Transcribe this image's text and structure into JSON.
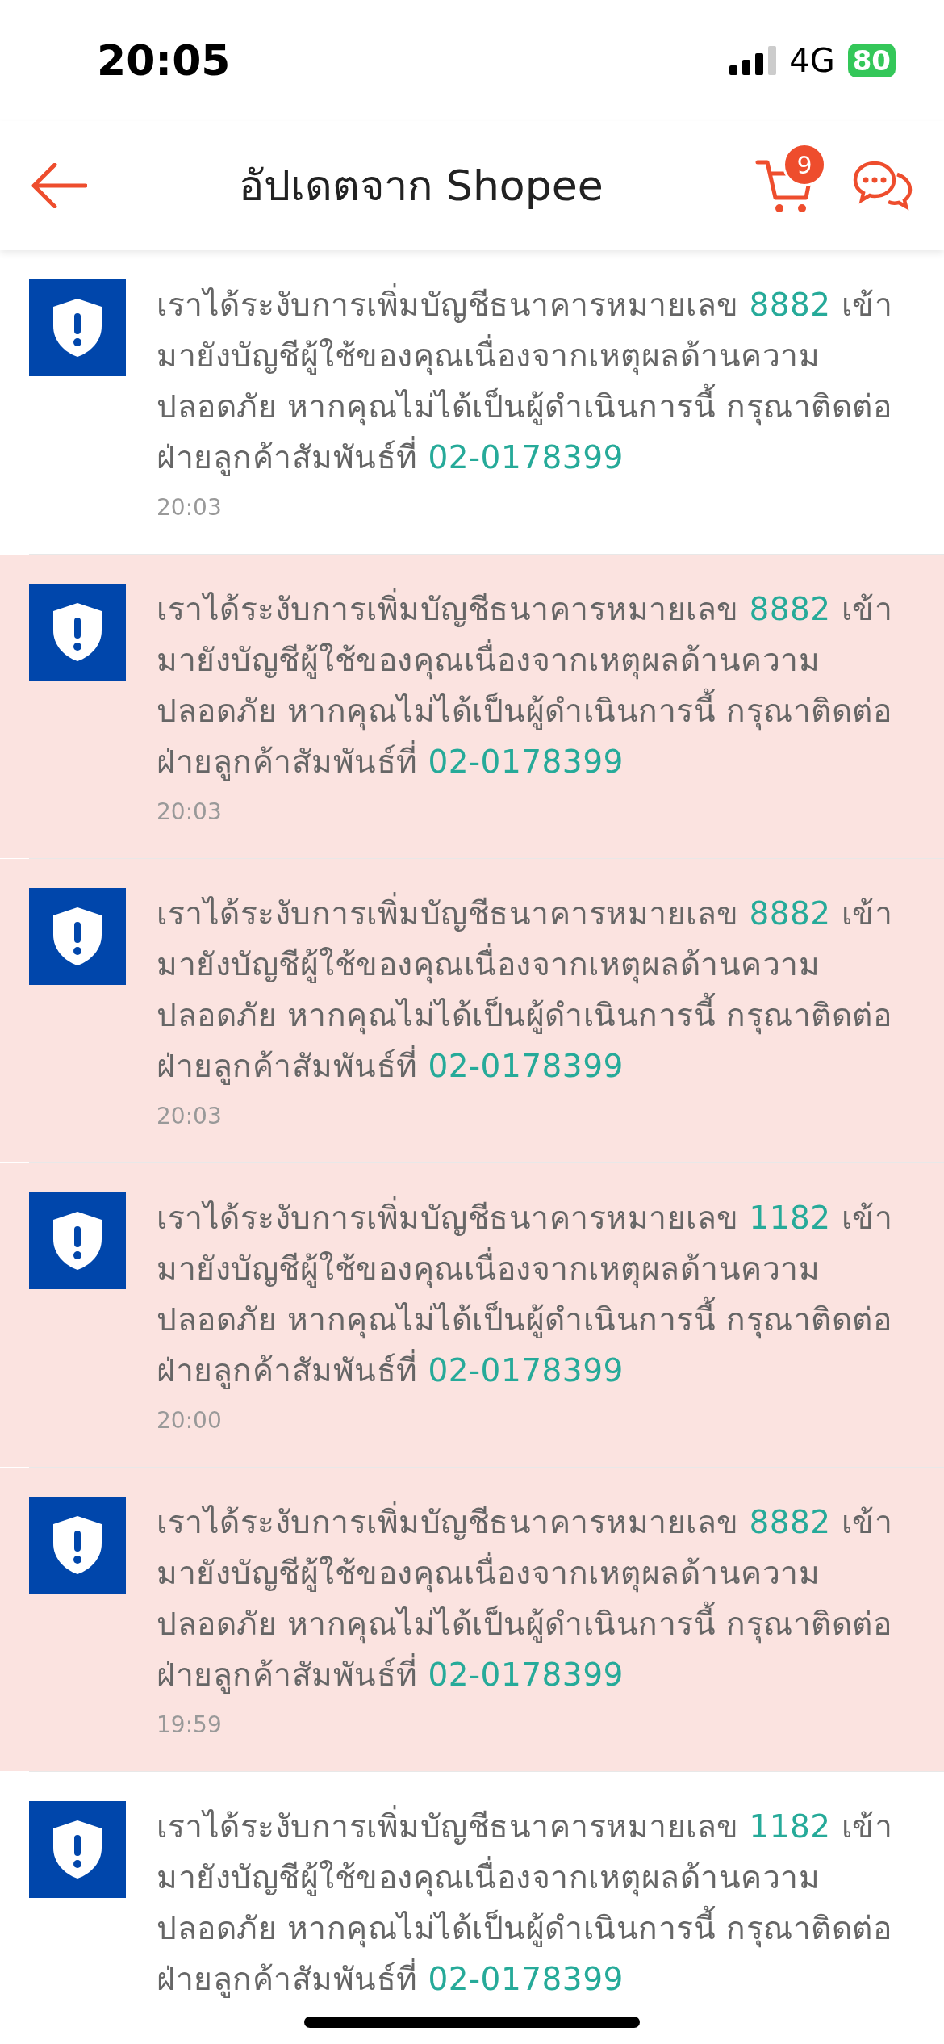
{
  "status_bar": {
    "time": "20:05",
    "network": "4G",
    "battery": "80"
  },
  "header": {
    "title": "อัปเดตจาก Shopee",
    "cart_count": "9"
  },
  "notifications": [
    {
      "read": true,
      "text_before": "เราได้ระงับการเพิ่มบัญชีธนาคารหมายเลข ",
      "account": "8882",
      "text_after": " เข้ามายังบัญชีผู้ใช้ของคุณเนื่องจากเหตุผลด้านความปลอดภัย หากคุณไม่ได้เป็นผู้ดำเนินการนี้ กรุณาติดต่อฝ่ายลูกค้าสัมพันธ์ที่ ",
      "phone": "02-0178399",
      "time": "20:03"
    },
    {
      "read": false,
      "text_before": "เราได้ระงับการเพิ่มบัญชีธนาคารหมายเลข ",
      "account": "8882",
      "text_after": " เข้ามายังบัญชีผู้ใช้ของคุณเนื่องจากเหตุผลด้านความปลอดภัย หากคุณไม่ได้เป็นผู้ดำเนินการนี้ กรุณาติดต่อฝ่ายลูกค้าสัมพันธ์ที่ ",
      "phone": "02-0178399",
      "time": "20:03"
    },
    {
      "read": false,
      "text_before": "เราได้ระงับการเพิ่มบัญชีธนาคารหมายเลข ",
      "account": "8882",
      "text_after": " เข้ามายังบัญชีผู้ใช้ของคุณเนื่องจากเหตุผลด้านความปลอดภัย หากคุณไม่ได้เป็นผู้ดำเนินการนี้ กรุณาติดต่อฝ่ายลูกค้าสัมพันธ์ที่ ",
      "phone": "02-0178399",
      "time": "20:03"
    },
    {
      "read": false,
      "text_before": "เราได้ระงับการเพิ่มบัญชีธนาคารหมายเลข ",
      "account": "1182",
      "text_after": " เข้ามายังบัญชีผู้ใช้ของคุณเนื่องจากเหตุผลด้านความปลอดภัย หากคุณไม่ได้เป็นผู้ดำเนินการนี้ กรุณาติดต่อฝ่ายลูกค้าสัมพันธ์ที่ ",
      "phone": "02-0178399",
      "time": "20:00"
    },
    {
      "read": false,
      "text_before": "เราได้ระงับการเพิ่มบัญชีธนาคารหมายเลข ",
      "account": "8882",
      "text_after": " เข้ามายังบัญชีผู้ใช้ของคุณเนื่องจากเหตุผลด้านความปลอดภัย หากคุณไม่ได้เป็นผู้ดำเนินการนี้ กรุณาติดต่อฝ่ายลูกค้าสัมพันธ์ที่ ",
      "phone": "02-0178399",
      "time": "19:59"
    },
    {
      "read": true,
      "text_before": "เราได้ระงับการเพิ่มบัญชีธนาคารหมายเลข ",
      "account": "1182",
      "text_after": " เข้ามายังบัญชีผู้ใช้ของคุณเนื่องจากเหตุผลด้านความปลอดภัย หากคุณไม่ได้เป็นผู้ดำเนินการนี้ กรุณาติดต่อฝ่ายลูกค้าสัมพันธ์ที่ ",
      "phone": "02-0178399"
    }
  ]
}
